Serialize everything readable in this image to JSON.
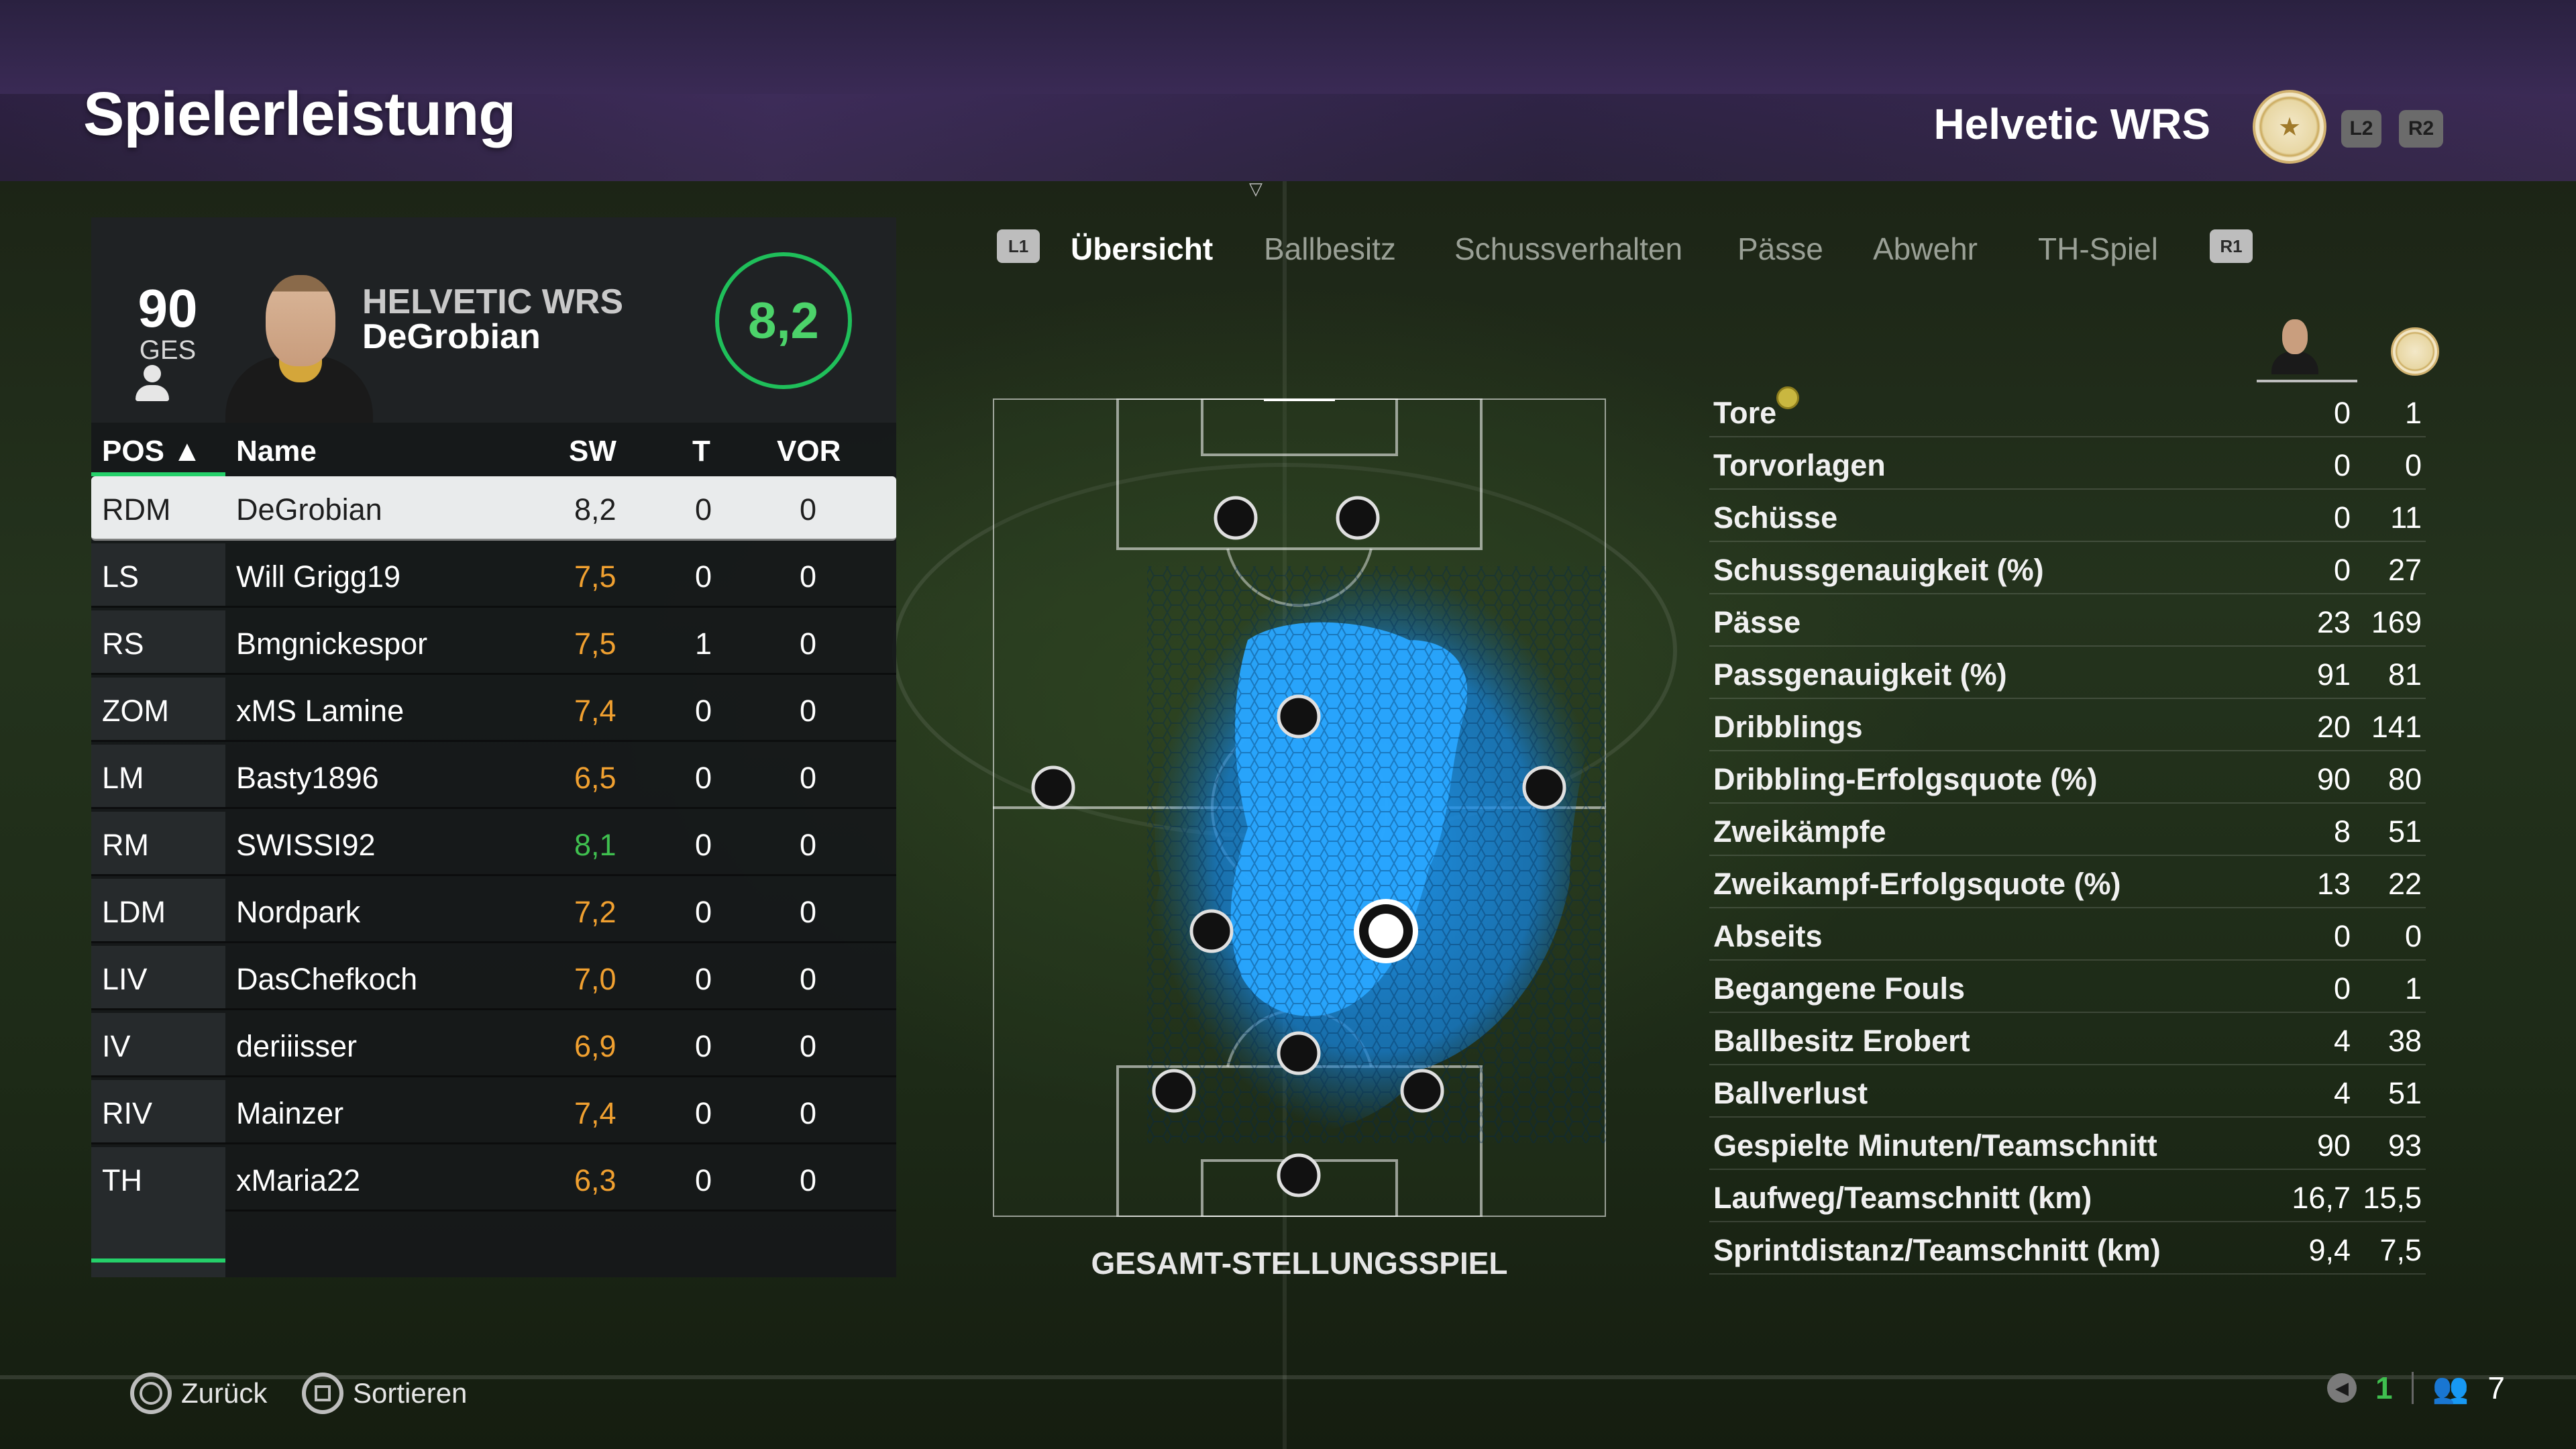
{
  "header": {
    "title": "Spielerleistung",
    "team_name": "Helvetic WRS",
    "l2_label": "L2",
    "r2_label": "R2"
  },
  "player_card": {
    "overall": "90",
    "overall_label": "GES",
    "club": "HELVETIC WRS",
    "name": "DeGrobian",
    "rating": "8,2"
  },
  "table": {
    "columns": {
      "pos": "POS ▲",
      "name": "Name",
      "sw": "SW",
      "t": "T",
      "vor": "VOR"
    },
    "rows": [
      {
        "pos": "RDM",
        "name": "DeGrobian",
        "sw": "8,2",
        "t": "0",
        "vor": "0",
        "rating_color": "#1e1e1e"
      },
      {
        "pos": "LS",
        "name": "Will Grigg19",
        "sw": "7,5",
        "t": "0",
        "vor": "0",
        "rating_color": "#f0a030"
      },
      {
        "pos": "RS",
        "name": "Bmgnickespor",
        "sw": "7,5",
        "t": "1",
        "vor": "0",
        "rating_color": "#f0a030"
      },
      {
        "pos": "ZOM",
        "name": "xMS Lamine",
        "sw": "7,4",
        "t": "0",
        "vor": "0",
        "rating_color": "#f0a030"
      },
      {
        "pos": "LM",
        "name": "Basty1896",
        "sw": "6,5",
        "t": "0",
        "vor": "0",
        "rating_color": "#f0a030"
      },
      {
        "pos": "RM",
        "name": "SWISSI92",
        "sw": "8,1",
        "t": "0",
        "vor": "0",
        "rating_color": "#3fbf4f"
      },
      {
        "pos": "LDM",
        "name": "Nordpark",
        "sw": "7,2",
        "t": "0",
        "vor": "0",
        "rating_color": "#f0a030"
      },
      {
        "pos": "LIV",
        "name": "DasChefkoch",
        "sw": "7,0",
        "t": "0",
        "vor": "0",
        "rating_color": "#f0a030"
      },
      {
        "pos": "IV",
        "name": "deriiisser",
        "sw": "6,9",
        "t": "0",
        "vor": "0",
        "rating_color": "#f0a030"
      },
      {
        "pos": "RIV",
        "name": "Mainzer",
        "sw": "7,4",
        "t": "0",
        "vor": "0",
        "rating_color": "#f0a030"
      },
      {
        "pos": "TH",
        "name": "xMaria22",
        "sw": "6,3",
        "t": "0",
        "vor": "0",
        "rating_color": "#f0a030"
      }
    ]
  },
  "tabs": {
    "l1": "L1",
    "r1": "R1",
    "items": [
      "Übersicht",
      "Ballbesitz",
      "Schussverhalten",
      "Pässe",
      "Abwehr",
      "TH-Spiel"
    ],
    "active": "Übersicht"
  },
  "field": {
    "caption": "GESAMT-STELLUNGSSPIEL",
    "heatmap_color": "#1a9bff"
  },
  "stats": [
    {
      "label": "Tore",
      "player": "0",
      "team": "1"
    },
    {
      "label": "Torvorlagen",
      "player": "0",
      "team": "0"
    },
    {
      "label": "Schüsse",
      "player": "0",
      "team": "11"
    },
    {
      "label": "Schussgenauigkeit (%)",
      "player": "0",
      "team": "27"
    },
    {
      "label": "Pässe",
      "player": "23",
      "team": "169"
    },
    {
      "label": "Passgenauigkeit (%)",
      "player": "91",
      "team": "81"
    },
    {
      "label": "Dribblings",
      "player": "20",
      "team": "141"
    },
    {
      "label": "Dribbling-Erfolgsquote (%)",
      "player": "90",
      "team": "80"
    },
    {
      "label": "Zweikämpfe",
      "player": "8",
      "team": "51"
    },
    {
      "label": "Zweikampf-Erfolgsquote (%)",
      "player": "13",
      "team": "22"
    },
    {
      "label": "Abseits",
      "player": "0",
      "team": "0"
    },
    {
      "label": "Begangene Fouls",
      "player": "0",
      "team": "1"
    },
    {
      "label": "Ballbesitz Erobert",
      "player": "4",
      "team": "38"
    },
    {
      "label": "Ballverlust",
      "player": "4",
      "team": "51"
    },
    {
      "label": "Gespielte Minuten/Teamschnitt",
      "player": "90",
      "team": "93"
    },
    {
      "label": "Laufweg/Teamschnitt (km)",
      "player": "16,7",
      "team": "15,5"
    },
    {
      "label": "Sprintdistanz/Teamschnitt (km)",
      "player": "9,4",
      "team": "7,5"
    }
  ],
  "footer": {
    "back_label": "Zurück",
    "sort_label": "Sortieren",
    "voice_count": "1",
    "players_count": "7"
  },
  "colors": {
    "accent_green": "#25d06a",
    "rating_orange": "#f0a030",
    "rating_green": "#3fbf4f",
    "heat_blue": "#1a9bff"
  }
}
